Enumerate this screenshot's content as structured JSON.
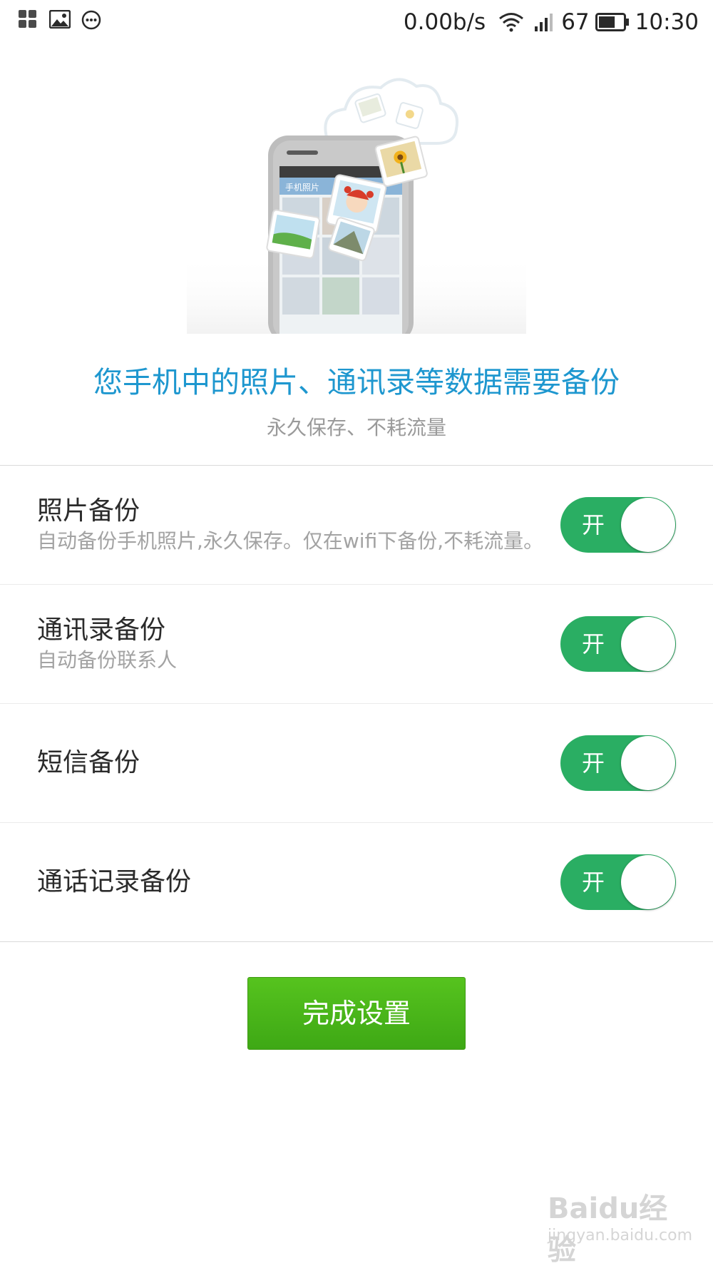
{
  "status_bar": {
    "icons_left": [
      "apps-grid-icon",
      "gallery-icon",
      "message-icon"
    ],
    "net_speed": "0.00b/s",
    "battery_level": "67",
    "battery_fraction": 0.67,
    "time": "10:30"
  },
  "hero": {
    "screen_title": "手机照片",
    "headline": "您手机中的照片、通讯录等数据需要备份",
    "subline": "永久保存、不耗流量"
  },
  "settings": [
    {
      "title": "照片备份",
      "desc": "自动备份手机照片,永久保存。仅在wifi下备份,不耗流量。",
      "toggle_label": "开",
      "on": true
    },
    {
      "title": "通讯录备份",
      "desc": "自动备份联系人",
      "toggle_label": "开",
      "on": true
    },
    {
      "title": "短信备份",
      "desc": "",
      "toggle_label": "开",
      "on": true
    },
    {
      "title": "通话记录备份",
      "desc": "",
      "toggle_label": "开",
      "on": true
    }
  ],
  "finish_button": "完成设置",
  "watermark": {
    "brand": "Baidu经验",
    "url": "jingyan.baidu.com"
  },
  "colors": {
    "headline": "#1e97cf",
    "toggle_on": "#2aae63",
    "button_green": "#4cb81b"
  }
}
